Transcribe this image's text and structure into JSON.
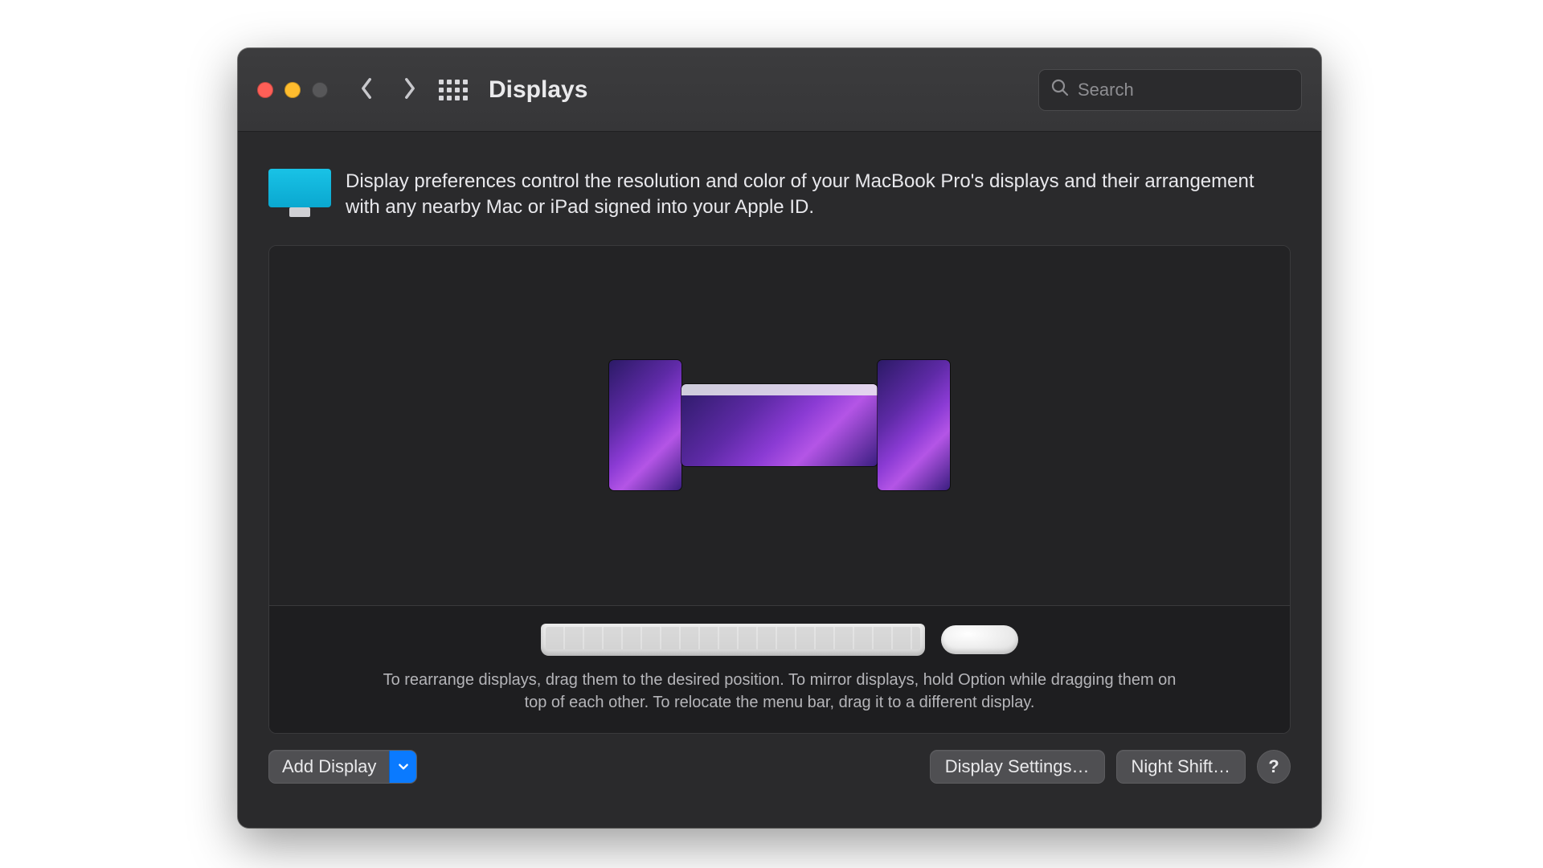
{
  "window": {
    "title": "Displays"
  },
  "search": {
    "placeholder": "Search",
    "value": ""
  },
  "header": {
    "description": "Display preferences control the resolution and color of your MacBook Pro's displays and their arrangement with any nearby Mac or iPad signed into your Apple ID."
  },
  "arrangement": {
    "hint": "To rearrange displays, drag them to the desired position. To mirror displays, hold Option while dragging them on top of each other. To relocate the menu bar, drag it to a different display."
  },
  "footer": {
    "add_display_label": "Add Display",
    "display_settings_label": "Display Settings…",
    "night_shift_label": "Night Shift…",
    "help_label": "?"
  },
  "icons": {
    "back": "chevron-left-icon",
    "forward": "chevron-right-icon",
    "grid": "grid-icon",
    "search": "search-icon",
    "dropdown": "chevron-down-icon",
    "display": "display-icon",
    "keyboard": "keyboard-icon",
    "mouse": "mouse-icon"
  }
}
